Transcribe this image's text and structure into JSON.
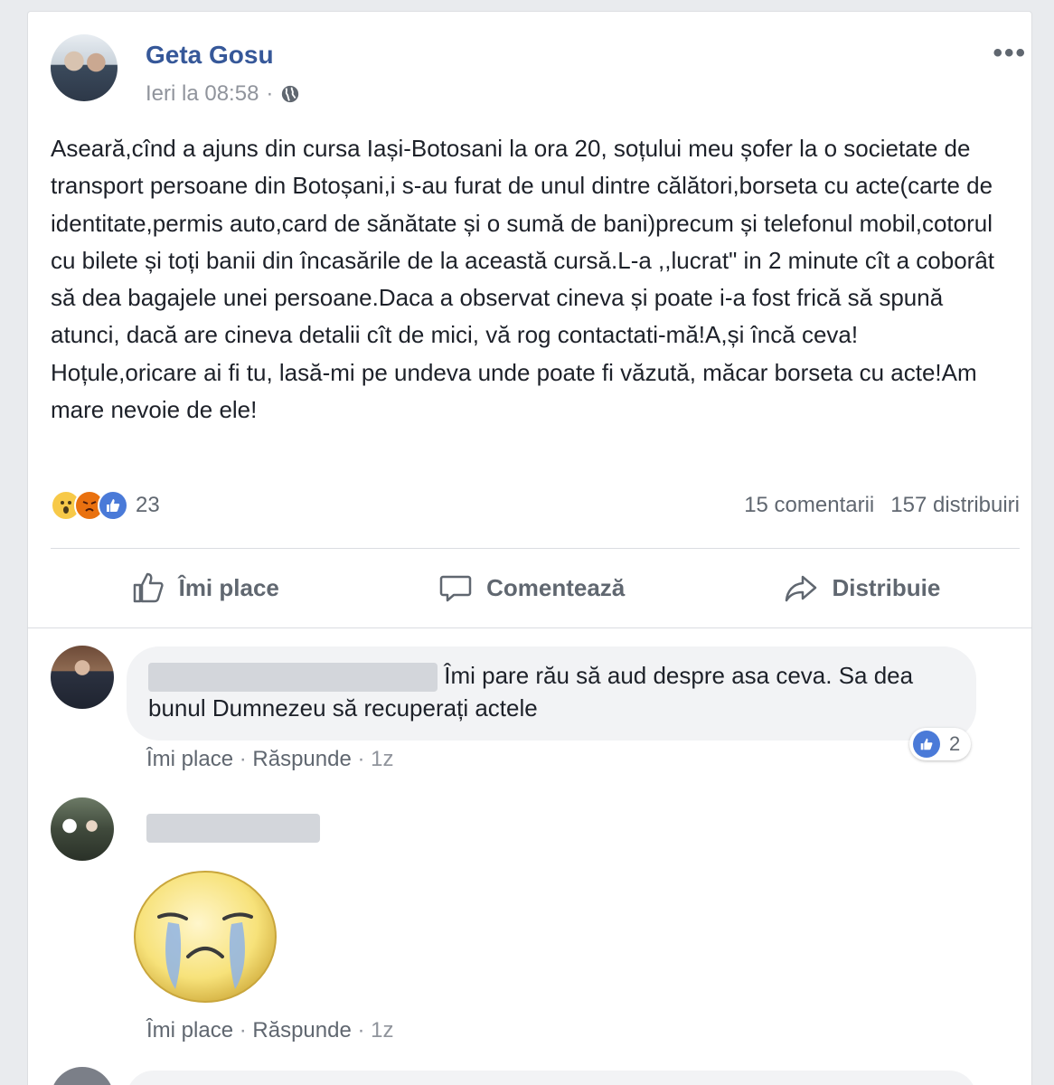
{
  "post": {
    "author": "Geta Gosu",
    "time": "Ieri la 08:58",
    "separator": "·",
    "more": "•••",
    "text": "Aseară,cînd a ajuns din cursa Iași-Botosani la ora 20, soțului meu șofer la o societate de transport persoane din Botoșani,i s-au furat de unul dintre călători,borseta cu acte(carte de identitate,permis auto,card de sănătate și o sumă de bani)precum și telefonul mobil,cotorul cu bilete și toți banii din încasările de la această cursă.L-a ,,lucrat\" in 2 minute cît a coborât să dea bagajele unei persoane.Daca a observat cineva și poate i-a fost frică să spună atunci, dacă are cineva detalii cît de mici, vă rog contactati-mă!A,și încă ceva! Hoțule,oricare ai fi tu, lasă-mi pe undeva unde poate fi văzută, măcar borseta cu acte!Am mare nevoie de ele!",
    "reactions": [
      "wow",
      "angry",
      "like"
    ],
    "reaction_count": "23",
    "comments_count": "15 comentarii",
    "shares_count": "157 distribuiri"
  },
  "actions": {
    "like": "Îmi place",
    "comment": "Comentează",
    "share": "Distribuie"
  },
  "comments": [
    {
      "name_hidden": true,
      "text": "Îmi pare rău să aud despre asa ceva. Sa dea bunul Dumnezeu să recuperați actele",
      "like_label": "Îmi place",
      "reply_label": "Răspunde",
      "time": "1z",
      "likes": "2"
    },
    {
      "name_hidden": true,
      "sticker": "crying-face",
      "like_label": "Îmi place",
      "reply_label": "Răspunde",
      "time": "1z"
    }
  ],
  "colors": {
    "link": "#365899",
    "secondary": "#606770",
    "muted": "#90949c",
    "like_blue": "#4a7ad8",
    "background": "#e9ebee"
  }
}
